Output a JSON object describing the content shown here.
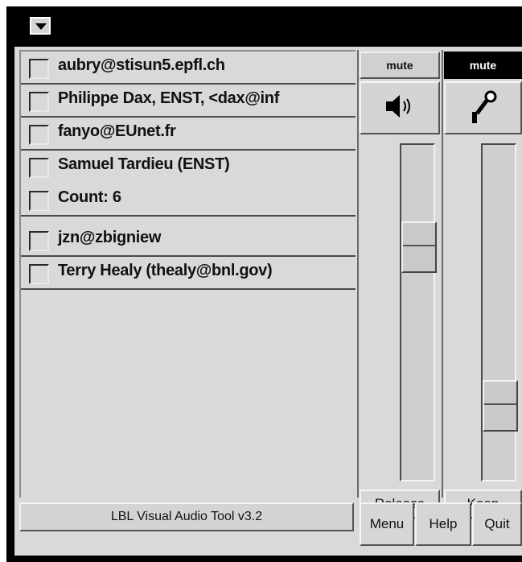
{
  "window": {
    "menu_icon": "down-triangle-icon"
  },
  "participants": [
    {
      "name": "aubry@stisun5.epfl.ch"
    },
    {
      "name": "Philippe Dax, ENST, <dax@inf"
    },
    {
      "name": "fanyo@EUnet.fr"
    },
    {
      "name": "Samuel Tardieu (ENST)"
    },
    {
      "name": "Count: 6"
    },
    {
      "name": "jzn@zbigniew"
    },
    {
      "name": "Terry Healy (thealy@bnl.gov)"
    }
  ],
  "speaker": {
    "mute_label": "mute",
    "muted": false,
    "icon": "speaker-icon",
    "volume_fraction": 0.73,
    "action_label": "Release"
  },
  "microphone": {
    "mute_label": "mute",
    "muted": true,
    "icon": "microphone-icon",
    "volume_fraction": 0.17,
    "action_label": "Keep"
  },
  "status": {
    "text": "LBL Visual Audio Tool v3.2"
  },
  "buttons": {
    "menu": "Menu",
    "help": "Help",
    "quit": "Quit"
  }
}
